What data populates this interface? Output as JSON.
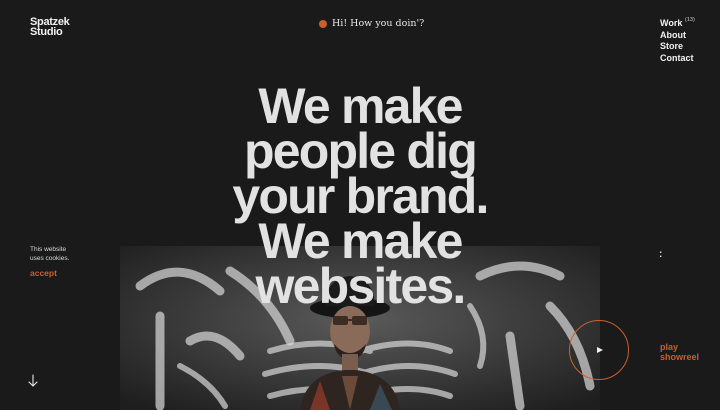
{
  "brand": {
    "line1": "Spatzek",
    "line2": "Studio"
  },
  "greeting": {
    "text": "Hi! How you doin'?",
    "dot_color": "#c9602c"
  },
  "nav": {
    "items": [
      {
        "label": "Work",
        "count": "(13)"
      },
      {
        "label": "About"
      },
      {
        "label": "Store"
      },
      {
        "label": "Contact"
      }
    ]
  },
  "headline": {
    "lines": [
      "We make",
      "people dig",
      "your brand.",
      "We make",
      "websites."
    ]
  },
  "cookie": {
    "line1": "This website",
    "line2": "uses cookies.",
    "accept_label": "accept"
  },
  "side": {
    "dots": ":"
  },
  "showreel": {
    "line1": "play",
    "line2": "showreel"
  },
  "colors": {
    "background": "#1a1a1a",
    "accent": "#c9602c",
    "text": "#e2e2e2"
  },
  "icons": {
    "play": "play-icon",
    "scroll": "arrow-down-icon"
  }
}
